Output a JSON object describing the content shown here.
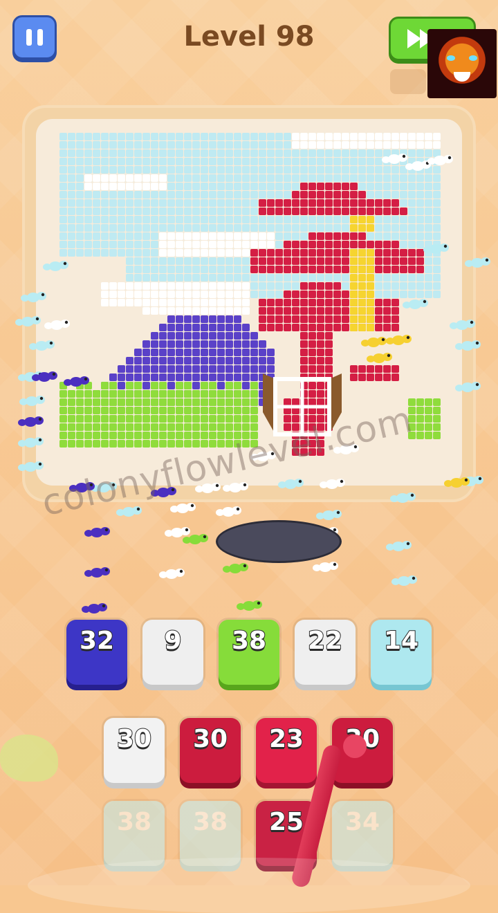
{
  "header": {
    "level_label": "Level 98"
  },
  "icons": {
    "pause": "pause-icon",
    "skip": "fast-forward-icon",
    "avatar": "tiger-avatar-icon",
    "hole": "ant-nest-hole-icon"
  },
  "watermark": "colonyflowlevel.com",
  "colors": {
    "sky": "#bfeaf2",
    "cloud": "#ffffff",
    "mountain": "#5a41c8",
    "grass": "#8fdc3c",
    "red": "#d41e44",
    "yellow": "#f6d430",
    "frame": "#f3d3a6",
    "background": "#f8c790"
  },
  "top_row": [
    {
      "value": "32",
      "color": "#3d36c6",
      "shade": "#27208f"
    },
    {
      "value": "9",
      "color": "#efefef",
      "shade": "#c8c8c8"
    },
    {
      "value": "38",
      "color": "#86dc3a",
      "shade": "#58a61c"
    },
    {
      "value": "22",
      "color": "#efefef",
      "shade": "#c8c8c8"
    },
    {
      "value": "14",
      "color": "#aee8ef",
      "shade": "#77c6d2"
    }
  ],
  "middle_row": [
    {
      "value": "30",
      "color": "#f2f2f2",
      "shade": "#c9c9c9"
    },
    {
      "value": "30",
      "color": "#cc1c3e",
      "shade": "#8c1026"
    },
    {
      "value": "23",
      "color": "#e2224a",
      "shade": "#a41532"
    },
    {
      "value": "30",
      "color": "#cc1c3e",
      "shade": "#8c1026"
    }
  ],
  "bottom_row": [
    {
      "value": "38",
      "color": "#bfeef3",
      "shade": "#9bd6df"
    },
    {
      "value": "38",
      "color": "#bfeef3",
      "shade": "#9bd6df"
    },
    {
      "value": "25",
      "color": "#c92244",
      "shade": "#8c1026"
    },
    {
      "value": "34",
      "color": "#bfeef3",
      "shade": "#9bd6df"
    }
  ]
}
